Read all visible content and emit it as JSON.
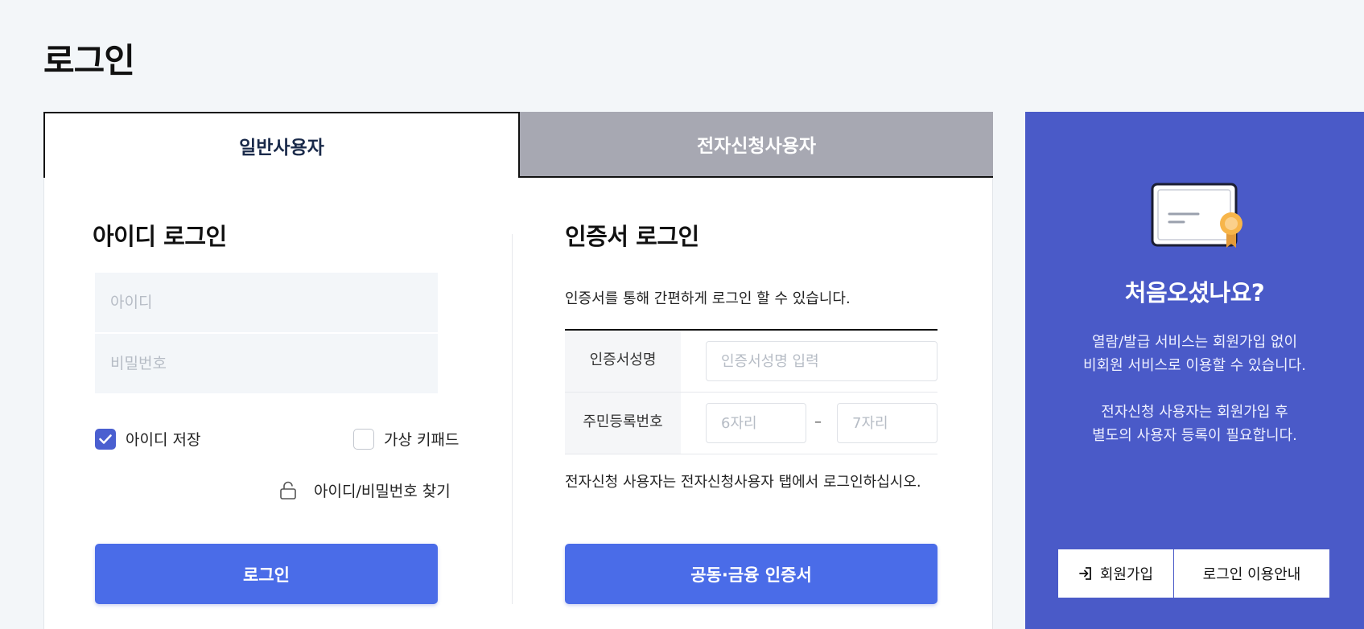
{
  "page": {
    "title": "로그인"
  },
  "tabs": [
    {
      "label": "일반사용자",
      "active": true
    },
    {
      "label": "전자신청사용자",
      "active": false
    }
  ],
  "id_login": {
    "title": "아이디 로그인",
    "id_placeholder": "아이디",
    "password_placeholder": "비밀번호",
    "save_id_label": "아이디 저장",
    "save_id_checked": true,
    "virtual_keypad_label": "가상 키패드",
    "virtual_keypad_checked": false,
    "find_link": "아이디/비밀번호 찾기",
    "login_button": "로그인"
  },
  "cert_login": {
    "title": "인증서 로그인",
    "description": "인증서를 통해 간편하게 로그인 할 수 있습니다.",
    "name_label": "인증서성명",
    "name_placeholder": "인증서성명 입력",
    "rrn_label": "주민등록번호",
    "rrn_first_placeholder": "6자리",
    "rrn_dash": "–",
    "rrn_second_placeholder": "7자리",
    "note": "전자신청 사용자는 전자신청사용자 탭에서 로그인하십시오.",
    "button": "공동·금융 인증서"
  },
  "promo": {
    "title": "처음오셨나요?",
    "text_1_line_1": "열람/발급 서비스는 회원가입 없이",
    "text_1_line_2": "비회원 서비스로 이용할 수 있습니다.",
    "text_2_line_1": "전자신청 사용자는 회원가입 후",
    "text_2_line_2": "별도의 사용자 등록이 필요합니다.",
    "join_button": "회원가입",
    "guide_button": "로그인 이용안내"
  },
  "colors": {
    "primary_button": "#4a6ce8",
    "promo_bg": "#4a5ac8",
    "inactive_tab": "#a7a8b2",
    "page_bg": "#f3f6f9"
  },
  "icons": {
    "checkbox": "check-icon",
    "find": "lock-icon",
    "certificate": "certificate-icon",
    "join": "login-arrow-icon"
  }
}
